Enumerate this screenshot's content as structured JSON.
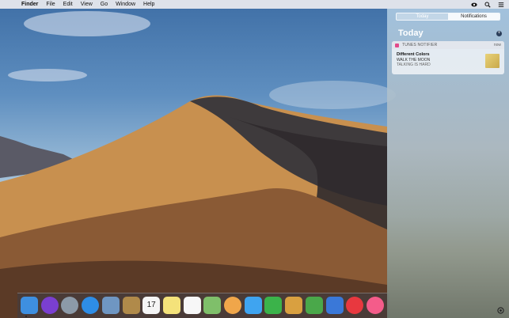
{
  "menubar": {
    "apple": "",
    "items": [
      "Finder",
      "File",
      "Edit",
      "View",
      "Go",
      "Window",
      "Help"
    ]
  },
  "status_icons": [
    "screen-mirroring-icon",
    "spotlight-search-icon",
    "notification-center-icon"
  ],
  "notification_center": {
    "tabs": [
      {
        "label": "Today",
        "active": true
      },
      {
        "label": "Notifications",
        "active": false
      }
    ],
    "heading": "Today",
    "notification": {
      "app": "TUNES NOTIFIER",
      "time": "now",
      "title": "Different Colors",
      "line1": "WALK THE MOON",
      "line2": "TALKING IS HARD"
    }
  },
  "dock": {
    "apps": [
      {
        "name": "Finder",
        "color": "#3e8fe0"
      },
      {
        "name": "Siri",
        "color": "#7a3fd0"
      },
      {
        "name": "Launchpad",
        "color": "#8c9aa8"
      },
      {
        "name": "Safari",
        "color": "#2e8de6"
      },
      {
        "name": "Preview",
        "color": "#6f96c2"
      },
      {
        "name": "Notebook",
        "color": "#b08a4a"
      },
      {
        "name": "Calendar",
        "color": "#f5f5f5",
        "text": "17"
      },
      {
        "name": "Notes",
        "color": "#f4e27a"
      },
      {
        "name": "Reminders",
        "color": "#f7f7f7"
      },
      {
        "name": "Maps",
        "color": "#7fbf6a"
      },
      {
        "name": "Photos",
        "color": "#f0a64a"
      },
      {
        "name": "Messages",
        "color": "#3fa4f0"
      },
      {
        "name": "FaceTime",
        "color": "#3bb34a"
      },
      {
        "name": "Keynote-Gallery",
        "color": "#d9a040"
      },
      {
        "name": "Numbers",
        "color": "#4aa84a"
      },
      {
        "name": "Keynote",
        "color": "#3a78d8"
      },
      {
        "name": "News",
        "color": "#e8383f"
      },
      {
        "name": "Music",
        "color": "#f45c8a"
      }
    ]
  }
}
